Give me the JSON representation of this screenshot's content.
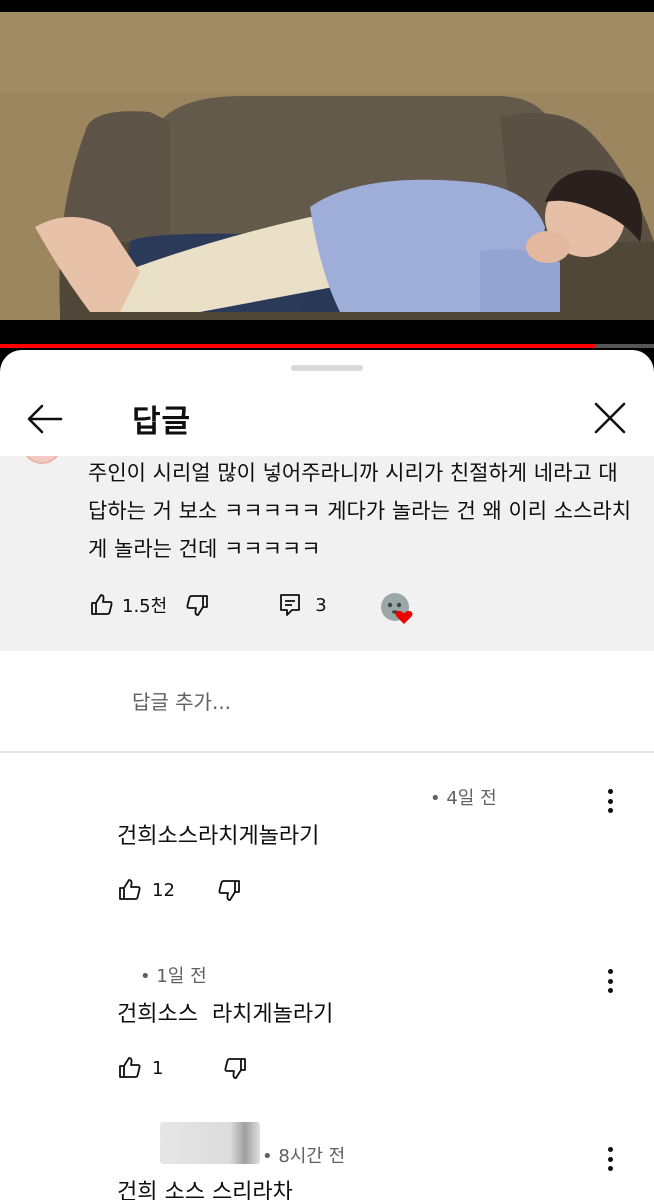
{
  "video": {
    "progress_fraction": 0.91,
    "progress_color": "#ff0000"
  },
  "sheet": {
    "title": "답글",
    "back_icon": "arrow-left-icon",
    "close_icon": "close-icon"
  },
  "parent_comment": {
    "text": "주인이 시리얼 많이 넣어주라니까 시리가 친절하게 네라고 대답하는 거 보소 ㅋㅋㅋㅋㅋ 게다가 놀라는 건 왜 이리 소스라치게 놀라는 건데 ㅋㅋㅋㅋㅋ",
    "likes": "1.5천",
    "reply_count": "3",
    "like_icon": "thumbs-up-icon",
    "dislike_icon": "thumbs-down-icon",
    "reply_icon": "comment-icon",
    "creator_heart_icon": "creator-heart-icon"
  },
  "add_reply": {
    "placeholder": "답글 추가..."
  },
  "replies": [
    {
      "meta": "• 4일 전",
      "text": "건희소스라치게놀라기",
      "likes": "12"
    },
    {
      "meta": "• 1일 전",
      "text": "건희소스  라치게놀라기",
      "likes": "1"
    },
    {
      "meta": "• 8시간 전",
      "text": "건희 소스 스리라차",
      "likes": ""
    }
  ]
}
